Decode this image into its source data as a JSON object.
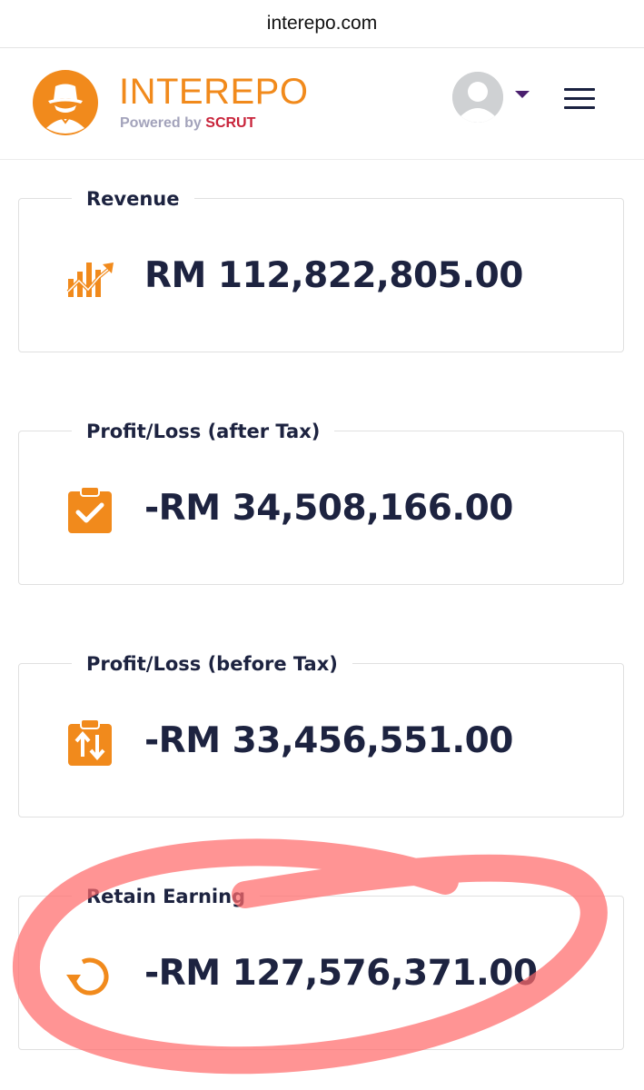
{
  "browser": {
    "url": "interepo.com"
  },
  "header": {
    "brand_name": "INTEREPO",
    "powered_by": "Powered by",
    "powered_brand": "SCRUT",
    "logo_icon": "spy-hat-icon",
    "avatar_icon": "user-avatar-icon",
    "dropdown_icon": "caret-down-icon",
    "menu_icon": "hamburger-menu-icon"
  },
  "colors": {
    "accent": "#f18a1c",
    "text_dark": "#1d2340",
    "scrut_red": "#c8233a",
    "highlight": "#ff6b6b"
  },
  "cards": [
    {
      "title": "Revenue",
      "value": "RM 112,822,805.00",
      "icon": "revenue-growth-icon"
    },
    {
      "title": "Profit/Loss (after Tax)",
      "value": "-RM 34,508,166.00",
      "icon": "clipboard-check-icon"
    },
    {
      "title": "Profit/Loss (before Tax)",
      "value": "-RM 33,456,551.00",
      "icon": "clipboard-sort-icon"
    },
    {
      "title": "Retain Earning",
      "value": "-RM 127,576,371.00",
      "icon": "refresh-icon"
    }
  ]
}
